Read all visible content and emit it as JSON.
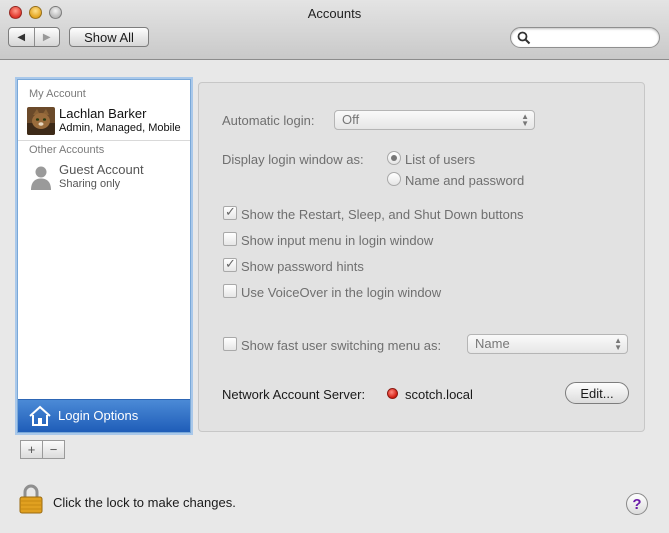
{
  "window": {
    "title": "Accounts"
  },
  "toolbar": {
    "back_glyph": "◀",
    "forward_glyph": "▶",
    "show_all_label": "Show All",
    "search_placeholder": ""
  },
  "sidebar": {
    "my_account_header": "My Account",
    "my_account": {
      "name": "Lachlan Barker",
      "subtitle": "Admin, Managed, Mobile"
    },
    "other_accounts_header": "Other Accounts",
    "guest": {
      "name": "Guest Account",
      "subtitle": "Sharing only"
    },
    "login_options_label": "Login Options",
    "add_glyph": "+",
    "remove_glyph": "−"
  },
  "login": {
    "auto_login_label": "Automatic login:",
    "auto_login_value": "Off",
    "display_label": "Display login window as:",
    "display_options": [
      {
        "label": "List of users",
        "selected": true
      },
      {
        "label": "Name and password",
        "selected": false
      }
    ],
    "checkboxes": [
      {
        "label": "Show the Restart, Sleep, and Shut Down buttons",
        "checked": true
      },
      {
        "label": "Show input menu in login window",
        "checked": false
      },
      {
        "label": "Show password hints",
        "checked": true
      },
      {
        "label": "Use VoiceOver in the login window",
        "checked": false
      }
    ],
    "fast_switch_label": "Show fast user switching menu as:",
    "fast_switch_checked": false,
    "fast_switch_value": "Name",
    "network_server_label": "Network Account Server:",
    "network_server_value": "scotch.local",
    "network_status_color": "#d21b10",
    "edit_label": "Edit..."
  },
  "footer": {
    "lock_text": "Click the lock to make changes.",
    "help_glyph": "?"
  }
}
